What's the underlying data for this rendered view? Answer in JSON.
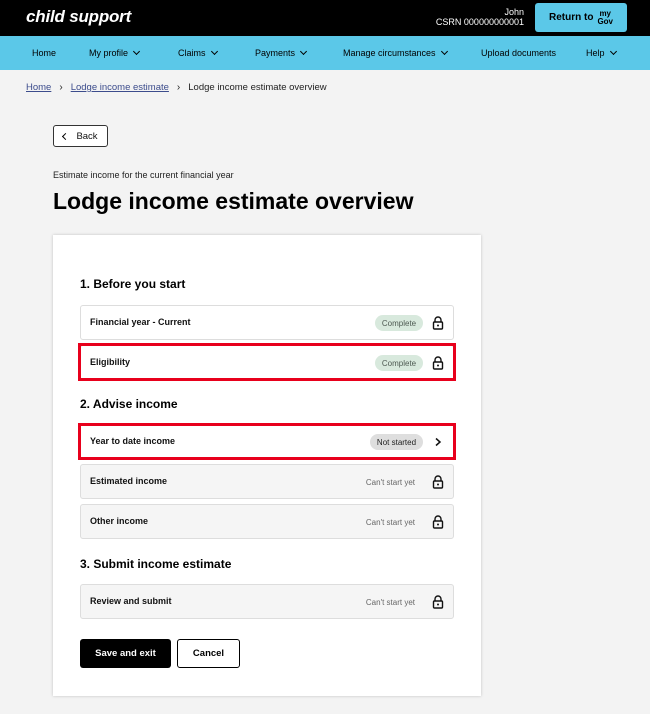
{
  "header": {
    "logo": "child support",
    "user_name": "John",
    "csrn": "CSRN 000000000001",
    "return_label": "Return to",
    "mygov_top": "my",
    "mygov_bottom": "Gov"
  },
  "nav": {
    "items": [
      {
        "label": "Home",
        "dropdown": false
      },
      {
        "label": "My profile",
        "dropdown": true
      },
      {
        "label": "Claims",
        "dropdown": true
      },
      {
        "label": "Payments",
        "dropdown": true
      },
      {
        "label": "Manage circumstances",
        "dropdown": true
      },
      {
        "label": "Upload documents",
        "dropdown": false
      },
      {
        "label": "Help",
        "dropdown": true
      }
    ]
  },
  "breadcrumb": {
    "home": "Home",
    "lodge": "Lodge income estimate",
    "current": "Lodge income estimate overview"
  },
  "back_label": "Back",
  "subtitle": "Estimate income for the current financial year",
  "title": "Lodge income estimate overview",
  "sections": [
    {
      "heading": "1. Before you start",
      "rows": [
        {
          "label": "Financial year - Current",
          "status": "Complete",
          "icon": "lock-icon"
        },
        {
          "label": "Eligibility",
          "status": "Complete",
          "icon": "lock-icon"
        }
      ]
    },
    {
      "heading": "2. Advise income",
      "rows": [
        {
          "label": "Year to date income",
          "status": "Not started",
          "icon": "chevron-right-icon"
        },
        {
          "label": "Estimated income",
          "status": "Can't start yet",
          "icon": "lock-icon"
        },
        {
          "label": "Other income",
          "status": "Can't start yet",
          "icon": "lock-icon"
        }
      ]
    },
    {
      "heading": "3. Submit income estimate",
      "rows": [
        {
          "label": "Review and submit",
          "status": "Can't start yet",
          "icon": "lock-icon"
        }
      ]
    }
  ],
  "actions": {
    "save": "Save and exit",
    "cancel": "Cancel"
  },
  "colors": {
    "nav_bg": "#5bc8e8",
    "highlight": "#e8001c",
    "complete_badge": "#d8e9dd"
  }
}
